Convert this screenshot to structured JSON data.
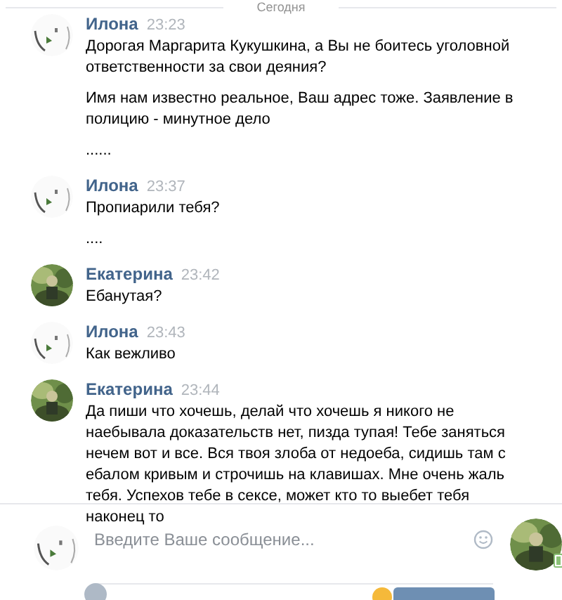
{
  "day_divider": "Сегодня",
  "messages": [
    {
      "author": "Илона",
      "time": "23:23",
      "paragraphs": [
        "Дорогая Маргарита Кукушкина, а Вы не боитесь уголовной ответственности за свои деяния?",
        "Имя нам известно реальное, Ваш адрес тоже. Заявление в полицию - минутное дело",
        "......"
      ]
    },
    {
      "author": "Илона",
      "time": "23:37",
      "paragraphs": [
        "Пропиарили тебя?",
        "...."
      ]
    },
    {
      "author": "Екатерина",
      "time": "23:42",
      "paragraphs": [
        "Ебанутая?"
      ]
    },
    {
      "author": "Илона",
      "time": "23:43",
      "paragraphs": [
        "Как вежливо"
      ]
    },
    {
      "author": "Екатерина",
      "time": "23:44",
      "paragraphs": [
        "Да пиши что хочешь, делай что хочешь я никого не наебывала доказательств нет, пизда тупая! Тебе заняться нечем вот и все. Вся твоя злоба от недоеба, сидишь там с ебалом кривым и строчишь на клавишах. Мне очень жаль тебя. Успехов тебе в сексе, может кто то выебет тебя наконец то"
      ]
    }
  ],
  "composer": {
    "placeholder": "Введите Ваше сообщение...",
    "peer_mobile": true
  }
}
